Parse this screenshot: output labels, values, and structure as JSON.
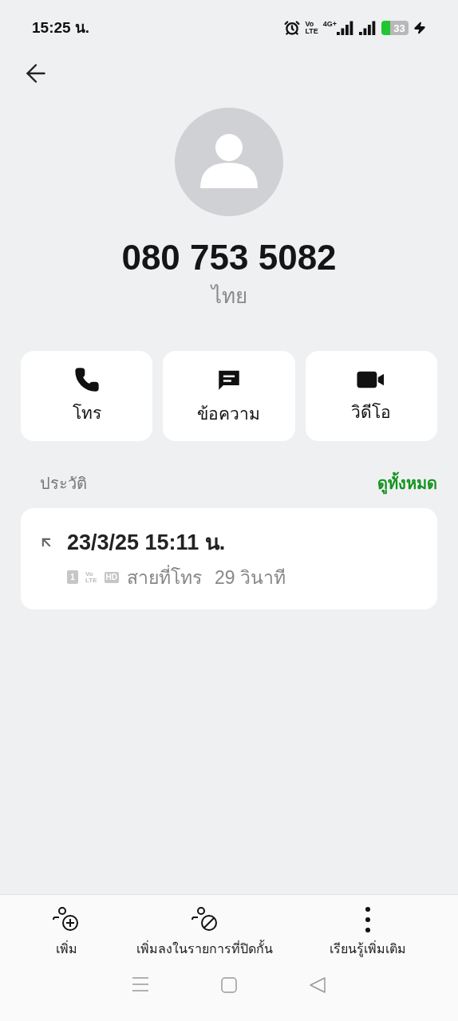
{
  "status_bar": {
    "time": "15:25 น.",
    "volte_top": "Vo",
    "volte_bottom": "LTE",
    "network": "4G+",
    "battery": "33"
  },
  "contact": {
    "number": "080 753 5082",
    "location": "ไทย"
  },
  "actions": [
    {
      "kind": "call",
      "label": "โทร"
    },
    {
      "kind": "message",
      "label": "ข้อความ"
    },
    {
      "kind": "video",
      "label": "วิดีโอ"
    }
  ],
  "history": {
    "title": "ประวัติ",
    "view_all": "ดูทั้งหมด",
    "entries": [
      {
        "kind": "outgoing",
        "datetime": "23/3/25 15:11 น.",
        "sim": "1",
        "volte_top": "Vo",
        "volte_bottom": "LTE",
        "hd": "HD",
        "type": "สายที่โทร",
        "duration": "29 วินาที"
      }
    ]
  },
  "bottom_actions": [
    {
      "kind": "add",
      "label": "เพิ่ม"
    },
    {
      "kind": "block",
      "label": "เพิ่มลงในรายการที่ปิดกั้น"
    },
    {
      "kind": "more",
      "label": "เรียนรู้เพิ่มเติม"
    }
  ]
}
